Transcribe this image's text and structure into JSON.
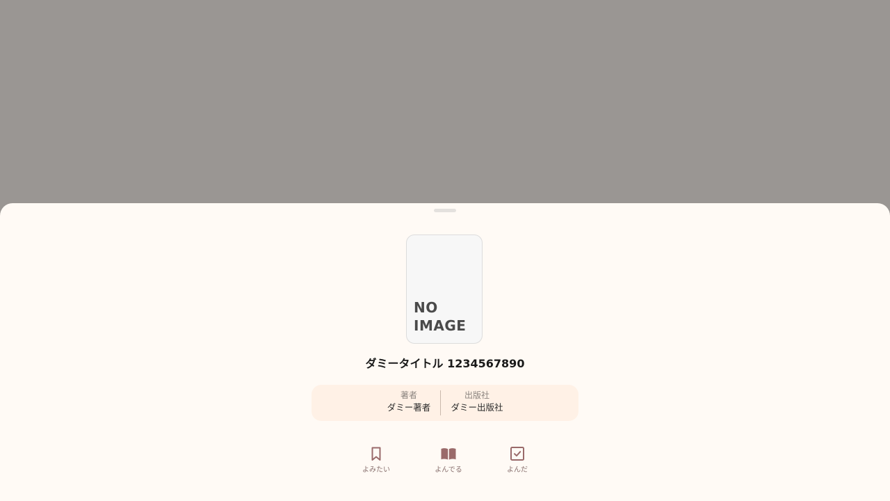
{
  "book": {
    "cover_text_line1": "NO",
    "cover_text_line2": "IMAGE",
    "title": "ダミータイトル 1234567890"
  },
  "info": {
    "author_label": "著者",
    "author_value": "ダミー著者",
    "publisher_label": "出版社",
    "publisher_value": "ダミー出版社"
  },
  "actions": [
    {
      "label": "よみたい",
      "icon": "bookmark-icon"
    },
    {
      "label": "よんでる",
      "icon": "open-book-icon"
    },
    {
      "label": "よんだ",
      "icon": "checkbox-icon"
    }
  ],
  "colors": {
    "overlay": "#9a9693",
    "sheet": "#fffaf5",
    "info_bg": "#fff1e6",
    "icon_accent": "#9a6a6a"
  }
}
